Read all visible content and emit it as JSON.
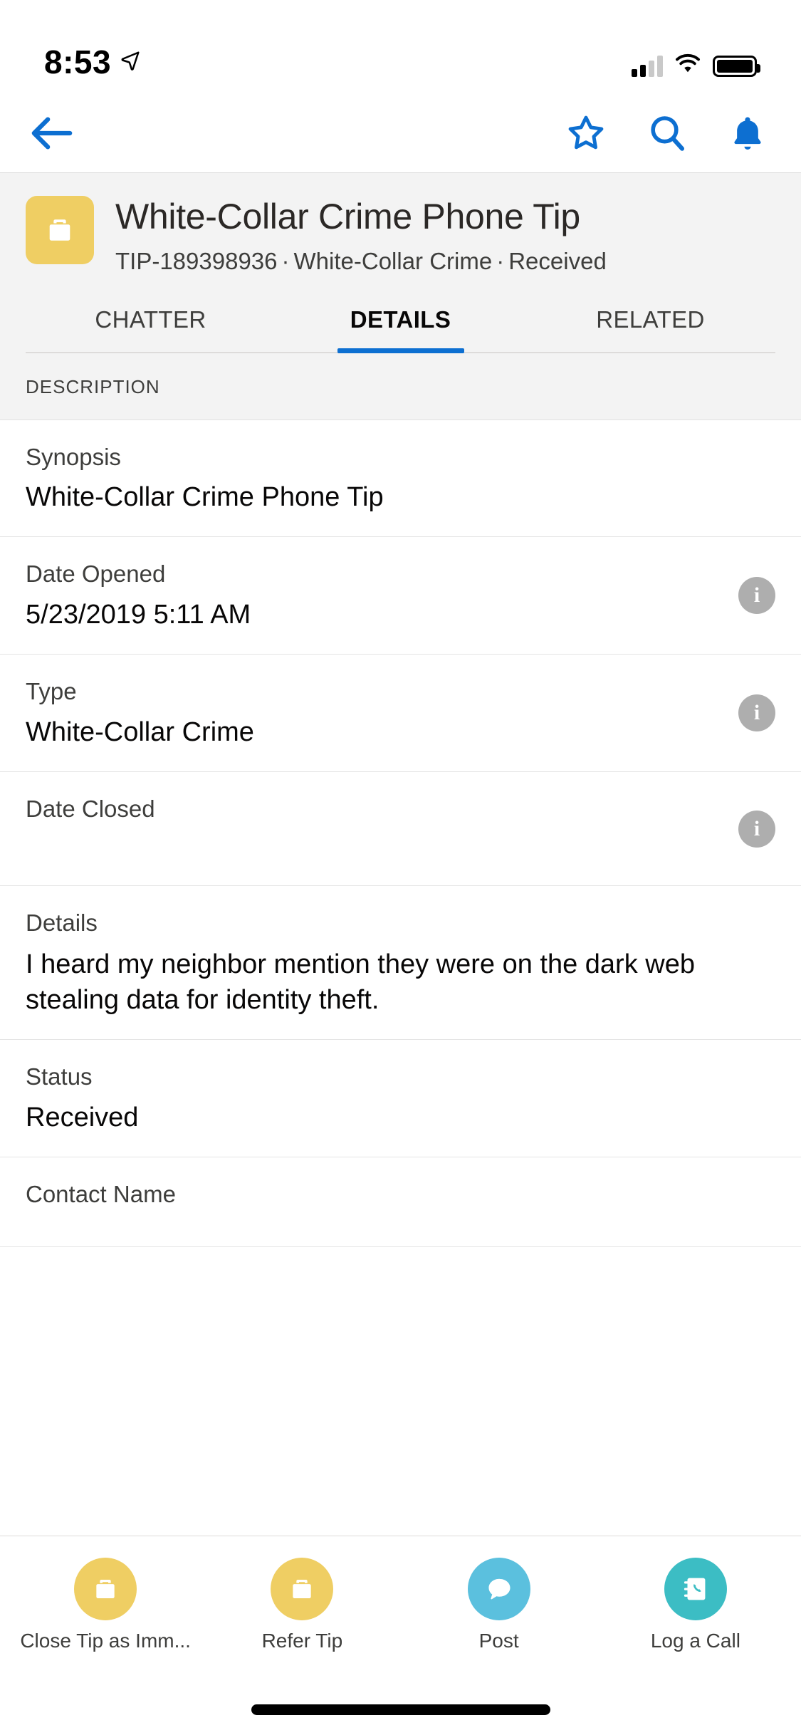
{
  "status_bar": {
    "time": "8:53",
    "location_icon": "location-arrow-icon",
    "signal_icon": "cellular-signal-icon",
    "wifi_icon": "wifi-icon",
    "battery_icon": "battery-full-icon"
  },
  "nav_bar": {
    "back_icon": "back-arrow-icon",
    "favorite_icon": "star-outline-icon",
    "search_icon": "search-icon",
    "notifications_icon": "bell-icon",
    "accent_color": "#0d6fd1"
  },
  "record": {
    "icon_name": "briefcase-icon",
    "icon_bg_color": "#efce63",
    "title": "White-Collar Crime Phone Tip",
    "subtitle_parts": [
      "TIP-189398936",
      "White-Collar Crime",
      "Received"
    ],
    "subtitle_separator": "·"
  },
  "tabs": [
    {
      "label": "CHATTER",
      "active": false
    },
    {
      "label": "DETAILS",
      "active": true
    },
    {
      "label": "RELATED",
      "active": false
    }
  ],
  "details": {
    "section_title": "DESCRIPTION",
    "fields": [
      {
        "label": "Synopsis",
        "value": "White-Collar Crime Phone Tip",
        "has_info": false
      },
      {
        "label": "Date Opened",
        "value": "5/23/2019 5:11 AM",
        "has_info": true
      },
      {
        "label": "Type",
        "value": "White-Collar Crime",
        "has_info": true
      },
      {
        "label": "Date Closed",
        "value": "",
        "has_info": true
      },
      {
        "label": "Details",
        "value": "I heard my neighbor mention they were on the dark web stealing data for identity theft.",
        "has_info": false
      },
      {
        "label": "Status",
        "value": "Received",
        "has_info": false
      },
      {
        "label": "Contact Name",
        "value": "",
        "has_info": false
      }
    ],
    "info_icon_glyph": "i",
    "info_icon_name": "info-icon"
  },
  "action_bar": [
    {
      "label": "Close Tip as Imm...",
      "icon_name": "briefcase-icon",
      "color": "#efce63"
    },
    {
      "label": "Refer Tip",
      "icon_name": "briefcase-icon",
      "color": "#efce63"
    },
    {
      "label": "Post",
      "icon_name": "chat-bubble-icon",
      "color": "#5bc0de"
    },
    {
      "label": "Log a Call",
      "icon_name": "phone-book-icon",
      "color": "#3cbdc4"
    }
  ],
  "home_indicator": "home-indicator"
}
